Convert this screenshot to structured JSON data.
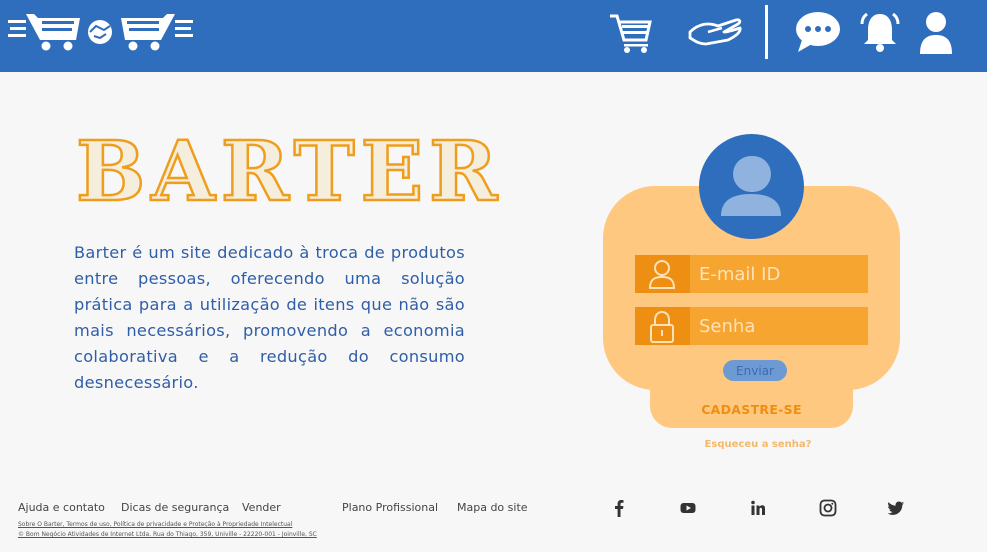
{
  "header": {
    "logo_name": "barter-logo",
    "icons": [
      "shopping-cart-icon",
      "handshake-icon",
      "chat-icon",
      "bell-icon",
      "user-icon"
    ]
  },
  "brand": {
    "title": "BARTER",
    "description": "Barter é um site dedicado à troca de produtos entre pessoas, oferecendo uma solução prática para a utilização de itens que não são mais necessários, promovendo a economia colaborativa e a redução do consumo desnecessário."
  },
  "login": {
    "email_placeholder": "E-mail ID",
    "password_placeholder": "Senha",
    "submit_label": "Enviar",
    "register_label": "CADASTRE-SE",
    "forgot_label": "Esqueceu a senha?"
  },
  "footer": {
    "links": [
      "Ajuda e contato",
      "Dicas de segurança",
      "Vender",
      "Plano Profissional",
      "Mapa do site"
    ],
    "legal_line1": "Sobre O Barter, Termos de uso, Política de privacidade e Proteção à Propriedade Intelectual",
    "legal_line2": "© Bom Negócio Atividades de Internet Ltda. Rua do Thiago, 359, Univille - 22220-001 - Joinville, SC",
    "social": [
      "facebook-icon",
      "youtube-icon",
      "linkedin-icon",
      "instagram-icon",
      "twitter-icon"
    ]
  },
  "colors": {
    "header_bg": "#2f6ebd",
    "accent_orange": "#f7a531",
    "card_bg": "#ffc880",
    "text_blue": "#2f5ea8"
  }
}
